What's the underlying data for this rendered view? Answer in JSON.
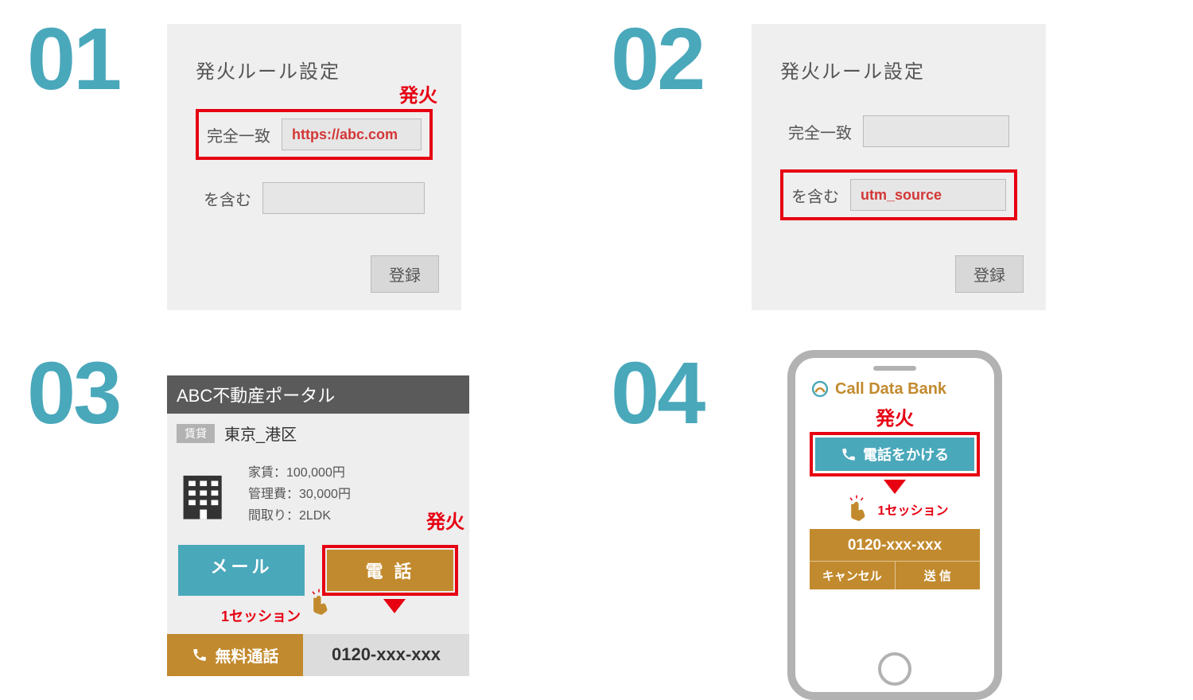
{
  "colors": {
    "accent": "#4aa8bb",
    "fire": "#e60012",
    "brown": "#c28a2e"
  },
  "nums": {
    "n1": "01",
    "n2": "02",
    "n3": "03",
    "n4": "04"
  },
  "fire_label": "発火",
  "panel": {
    "title": "発火ルール設定",
    "exact_label": "完全一致",
    "contains_label": "を含む",
    "register": "登録",
    "p1_value": "https://abc.com",
    "p2_value": "utm_source"
  },
  "portal": {
    "title": "ABC不動産ポータル",
    "tag": "賃貸",
    "area": "東京_港区",
    "spec_rent": "家賃：100,000円",
    "spec_fee": "管理費：30,000円",
    "spec_layout": "間取り：2LDK",
    "mail": "メール",
    "tel": "電 話",
    "free_call": "無料通話",
    "number": "0120-xxx-xxx",
    "session": "1セッション"
  },
  "phone": {
    "brand": "Call Data Bank",
    "call": "電話をかける",
    "session": "1セッション",
    "number": "0120-xxx-xxx",
    "cancel": "キャンセル",
    "send": "送 信"
  }
}
